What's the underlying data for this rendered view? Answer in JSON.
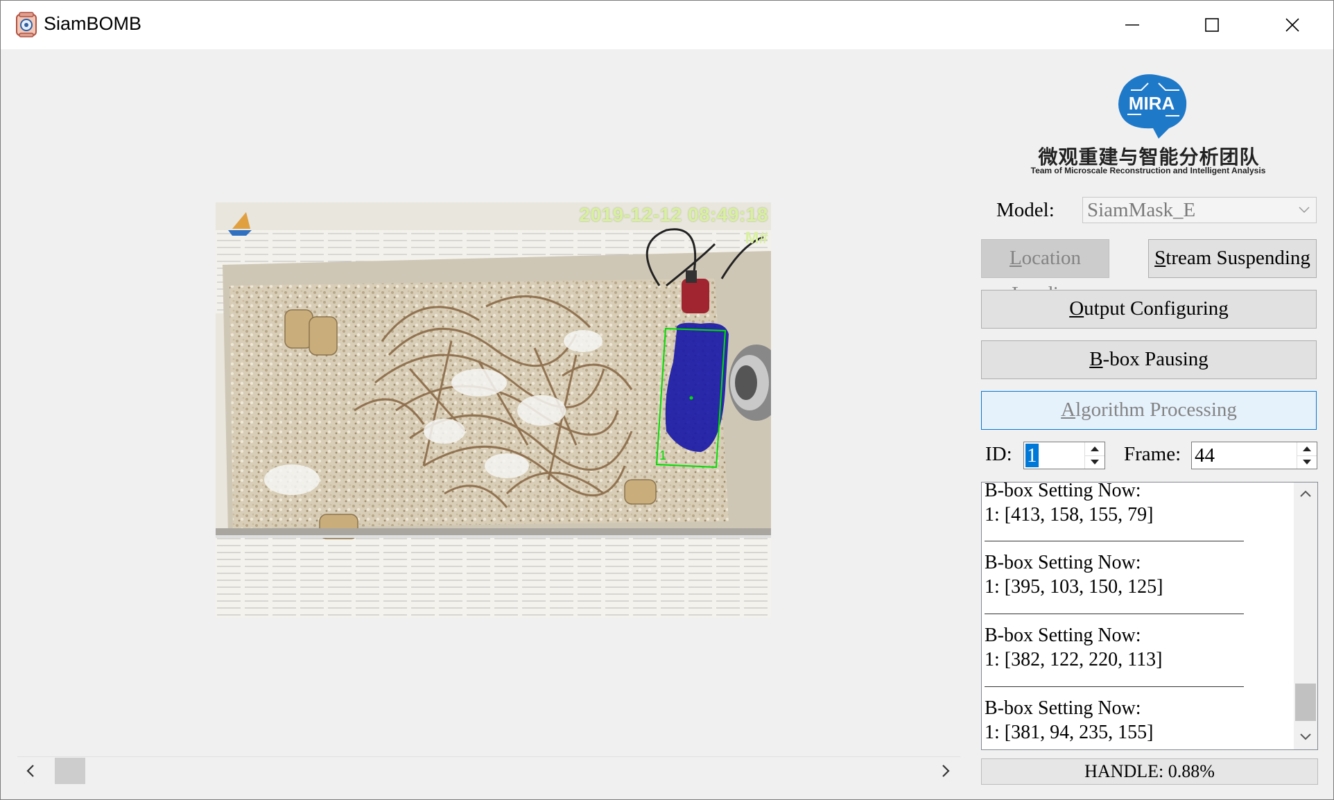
{
  "window": {
    "title": "SiamBOMB"
  },
  "video": {
    "timestamp": "2019-12-12 08:49:18",
    "osd_code": "M#",
    "track_id_label": "1"
  },
  "logo": {
    "text_cn": "微观重建与智能分析团队",
    "text_en": "Team of Microscale Reconstruction and Intelligent Analysis",
    "brand": "MIRA",
    "brand_color": "#1f79c9"
  },
  "model": {
    "label": "Model:",
    "value": "SiamMask_E"
  },
  "buttons": {
    "location_loading": {
      "mnemonic": "L",
      "rest": "ocation Loading"
    },
    "stream_suspending": {
      "mnemonic": "S",
      "rest": "tream Suspending"
    },
    "output_configuring": {
      "mnemonic": "O",
      "rest": "utput Configuring"
    },
    "bbox_pausing": {
      "mnemonic": "B",
      "rest": "-box Pausing"
    },
    "algorithm_processing": {
      "mnemonic": "A",
      "rest": "lgorithm Processing"
    }
  },
  "id": {
    "label": "ID:",
    "value": "1"
  },
  "frame": {
    "label": "Frame:",
    "value": "44"
  },
  "log": {
    "entries": [
      {
        "heading": "B-box Setting Now:",
        "value": "1: [413, 158, 155, 79]"
      },
      {
        "heading": "B-box Setting Now:",
        "value": "1: [395, 103, 150, 125]"
      },
      {
        "heading": "B-box Setting Now:",
        "value": "1: [382, 122, 220, 113]"
      },
      {
        "heading": "B-box Setting Now:",
        "value": "1: [381, 94, 235, 155]"
      }
    ],
    "scroll_position": 0.95
  },
  "status": {
    "text": "HANDLE: 0.88%"
  },
  "colors": {
    "accent": "#0078d7",
    "bbox_green": "#00e000",
    "mask_blue": "#1a1aa8"
  }
}
